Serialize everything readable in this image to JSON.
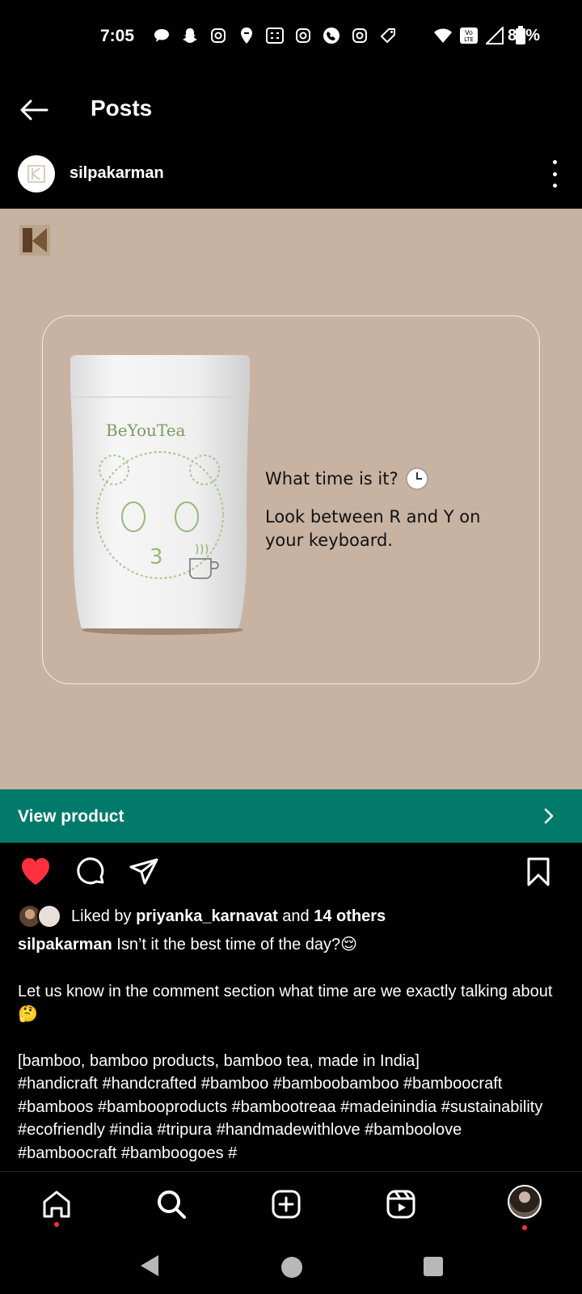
{
  "status_bar": {
    "time": "7:05",
    "battery": "84%",
    "icons": [
      "chat-icon",
      "snapchat-icon",
      "instagram-icon",
      "swiggy-icon",
      "calculator-icon",
      "instagram-icon",
      "phone-icon",
      "instagram-icon",
      "tag-icon",
      "wifi-icon",
      "volte-icon",
      "signal-icon",
      "battery-icon"
    ]
  },
  "header": {
    "title": "Posts"
  },
  "post": {
    "author": "silpakarman",
    "image": {
      "background": "#c8b2a2",
      "pouch_brand": "BeYouTea",
      "question": "What time is it?",
      "hint": "Look between R and Y on your keyboard."
    },
    "cta": {
      "label": "View product",
      "color": "#027a6b"
    },
    "liked": true,
    "likes": {
      "prefix": "Liked by",
      "user": "priyanka_karnavat",
      "joiner": "and",
      "others": "14 others"
    },
    "caption": {
      "user": "silpakarman",
      "line1": "Isn’t it the best time of the day?😌",
      "line2": "Let us know in the comment section what time are we exactly talking about 🤔",
      "line3": "[bamboo, bamboo products, bamboo tea, made in India]",
      "line4": "#handicraft #handcrafted #bamboo #bamboobamboo #bamboocraft #bamboos #bambooproducts #bambootreaa #madeinindia #sustainability",
      "line5": "#ecofriendly #india #tripura #handmadewithlove #bamboolove",
      "line6": "#bamboocraft #bamboogoes #"
    }
  },
  "bottom_nav": {
    "items": [
      "home-icon",
      "search-icon",
      "create-icon",
      "reels-icon",
      "profile-avatar"
    ]
  },
  "colors": {
    "like_red": "#ff3040",
    "notification_dot": "#ff3040"
  }
}
